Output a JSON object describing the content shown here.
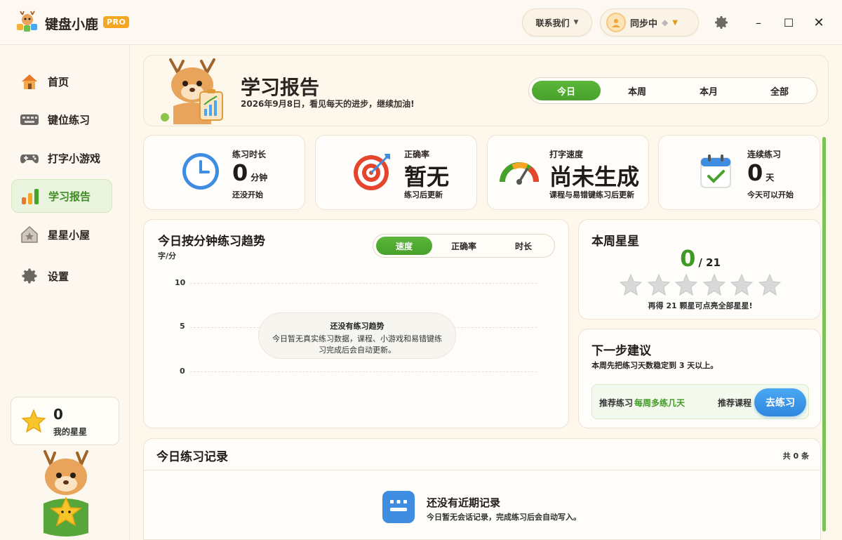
{
  "app": {
    "name": "键盘小鹿",
    "badge": "PRO"
  },
  "titlebar": {
    "contact_label": "联系我们",
    "sync_label": "同步中",
    "window_controls": {
      "minimize": "–",
      "maximize": "☐",
      "close": "✕"
    }
  },
  "sidebar": {
    "items": [
      {
        "label": "首页",
        "icon": "house-icon",
        "active": false
      },
      {
        "label": "键位练习",
        "icon": "keyboard-icon",
        "active": false
      },
      {
        "label": "打字小游戏",
        "icon": "gamepad-icon",
        "active": false
      },
      {
        "label": "学习报告",
        "icon": "bar-chart-icon",
        "active": true
      },
      {
        "label": "星星小屋",
        "icon": "star-house-icon",
        "active": false
      },
      {
        "label": "设置",
        "icon": "gear-icon",
        "active": false
      }
    ],
    "stars": {
      "count": "0",
      "label": "我的星星"
    }
  },
  "header": {
    "title": "学习报告",
    "subtitle": "2026年9月8日，看见每天的进步，继续加油!",
    "range_tabs": [
      "今日",
      "本周",
      "本月",
      "全部"
    ],
    "active_range": "今日"
  },
  "stats": [
    {
      "label": "练习时长",
      "value": "0",
      "unit": "分钟",
      "note": "还没开始",
      "icon": "clock-icon"
    },
    {
      "label": "正确率",
      "value": "暂无",
      "unit": "",
      "note": "练习后更新",
      "icon": "target-icon"
    },
    {
      "label": "打字速度",
      "value": "尚未生成",
      "unit": "",
      "note": "课程与易错键练习后更新",
      "icon": "speedometer-icon"
    },
    {
      "label": "连续练习",
      "value": "0",
      "unit": "天",
      "note": "今天可以开始",
      "icon": "calendar-icon"
    }
  ],
  "trend": {
    "title": "今日按分钟练习趋势",
    "unit": "字/分",
    "metric_tabs": [
      "速度",
      "正确率",
      "时长"
    ],
    "active_metric": "速度",
    "y_ticks": [
      "10",
      "5",
      "0"
    ],
    "empty_title": "还没有练习趋势",
    "empty_desc": "今日暂无真实练习数据，课程、小游戏和易错键练习完成后会自动更新。"
  },
  "chart_data": {
    "type": "line",
    "title": "今日按分钟练习趋势",
    "ylabel": "字/分",
    "ylim": [
      0,
      10
    ],
    "yticks": [
      0,
      5,
      10
    ],
    "series": [],
    "grid": true
  },
  "weekly_stars": {
    "title": "本周星星",
    "earned": "0",
    "total": "/ 21",
    "stars_earned": 0,
    "stars_total": 6,
    "hint": "再得 21 颗星可点亮全部星星!"
  },
  "suggestion": {
    "title": "下一步建议",
    "desc": "本周先把练习天数稳定到 3 天以上。",
    "rec_label": "推荐练习",
    "rec_value": "每周多练几天",
    "course_label": "推荐课程",
    "button": "去练习"
  },
  "records": {
    "title": "今日练习记录",
    "count": "共 0 条",
    "empty_title": "还没有近期记录",
    "empty_desc": "今日暂无会话记录，完成练习后会自动写入。"
  },
  "colors": {
    "accent_green": "#47a12b",
    "accent_blue": "#2f86de",
    "badge_orange": "#f5a623"
  }
}
